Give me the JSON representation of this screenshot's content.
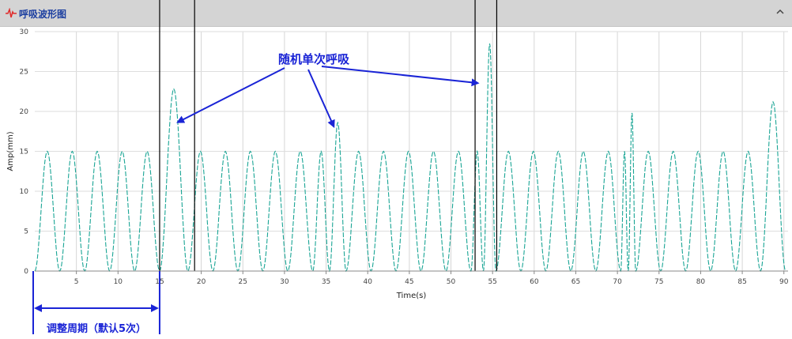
{
  "panel": {
    "title": "呼吸波形图",
    "icon": "waveform-icon",
    "collapse_icon": "chevron-up-icon"
  },
  "colors": {
    "accent": "#1c3fa0",
    "wave": "#1aa595",
    "annotation": "#1a24d6",
    "marker": "#000000"
  },
  "annotations": {
    "random_breath": "随机单次呼吸",
    "adjust_period": "调整周期（默认5次）"
  },
  "chart_data": {
    "type": "line",
    "title": "",
    "xlabel": "Time(s)",
    "ylabel": "Amp(mm)",
    "xlim": [
      0,
      90.5
    ],
    "ylim": [
      0,
      30
    ],
    "xticks": [
      5,
      10,
      15,
      20,
      25,
      30,
      35,
      40,
      45,
      50,
      55,
      60,
      65,
      70,
      75,
      80,
      85,
      90
    ],
    "yticks": [
      0,
      5,
      10,
      15,
      20,
      25,
      30
    ],
    "grid": true,
    "legend": "none",
    "series": [
      {
        "line_style": "dashed",
        "x": [
          0,
          1.5,
          3,
          4.5,
          6,
          7.5,
          9,
          10.5,
          12,
          13.5,
          15,
          16.7,
          18.4,
          19.9,
          21.4,
          22.9,
          24.4,
          25.9,
          27.4,
          28.9,
          30.4,
          31.9,
          33.4,
          34.4,
          35.4,
          36.4,
          37.4,
          38.9,
          40.4,
          41.9,
          43.4,
          44.9,
          46.4,
          47.9,
          49.4,
          50.9,
          52.4,
          53.15,
          53.9,
          54.65,
          55.4,
          56.9,
          58.4,
          59.9,
          61.4,
          62.9,
          64.4,
          65.9,
          67.4,
          68.9,
          70.4,
          70.85,
          71.3,
          71.75,
          72.2,
          73.7,
          75.2,
          76.7,
          78.2,
          79.7,
          81.2,
          82.7,
          84.2,
          85.7,
          87.2,
          88.7,
          90.2,
          90.5
        ],
        "y": [
          0,
          15,
          0,
          15,
          0,
          15,
          0,
          15,
          0,
          15,
          0,
          22.8,
          0,
          15,
          0,
          15,
          0,
          15,
          0,
          15,
          0,
          15,
          0,
          15,
          0,
          18.6,
          0,
          15,
          0,
          15,
          0,
          15,
          0,
          15,
          0,
          15,
          0,
          15,
          0,
          28.5,
          0,
          15,
          0,
          15,
          0,
          15,
          0,
          15,
          0,
          15,
          0,
          15,
          0,
          19.8,
          0,
          15,
          0,
          15,
          0,
          15,
          0,
          15,
          0,
          15,
          0,
          21.2,
          0,
          0
        ]
      }
    ],
    "marker_lines_x": [
      15.0,
      19.2,
      52.9,
      55.5
    ],
    "random_breath_times": [
      16.7,
      36.4,
      53.9
    ],
    "adjust_period_range": [
      0,
      15.0
    ]
  }
}
